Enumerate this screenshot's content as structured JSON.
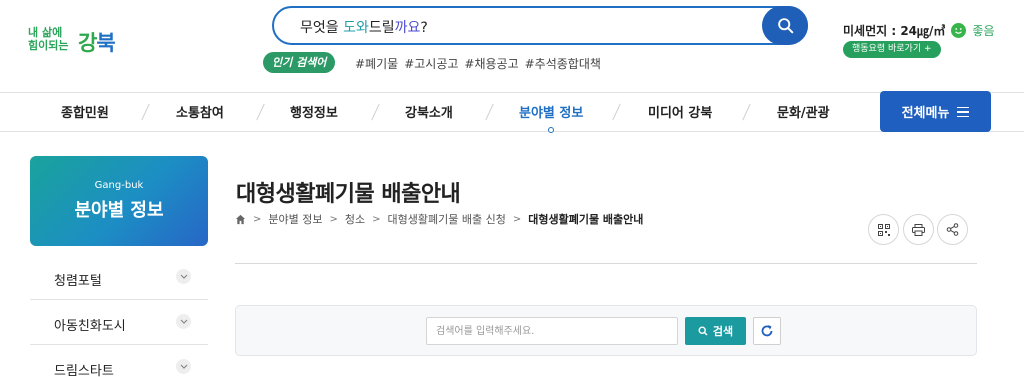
{
  "header": {
    "logo": {
      "line1": "내 삶에",
      "line2": "힘이되는",
      "brand_a": "강",
      "brand_b": "북"
    },
    "search": {
      "q_pre": "무엇을 ",
      "q_hl1": "도와",
      "q_mid": "드릴",
      "q_hl2": "까요",
      "q_end": "?"
    },
    "popular_label": "인기 검색어",
    "tags": [
      "#폐기물",
      "#고시공고",
      "#채용공고",
      "#추석종합대책"
    ],
    "dust_label": "미세먼지 : 24㎍/㎥",
    "dust_status": "좋음",
    "action_link": "행동요령 바로가기 +"
  },
  "gnb": {
    "items": [
      {
        "label": "종합민원"
      },
      {
        "label": "소통참여"
      },
      {
        "label": "행정정보"
      },
      {
        "label": "강북소개"
      },
      {
        "label": "분야별 정보"
      },
      {
        "label": "미디어 강북"
      },
      {
        "label": "문화/관광"
      }
    ],
    "all_menu": "전체메뉴"
  },
  "side": {
    "title_en": "Gang-buk",
    "title_ko": "분야별 정보",
    "items": [
      {
        "label": "청렴포털"
      },
      {
        "label": "아동친화도시"
      },
      {
        "label": "드림스타트"
      }
    ]
  },
  "content": {
    "title": "대형생활폐기물 배출안내",
    "breadcrumb": [
      "분야별 정보",
      "청소",
      "대형생활폐기물 배출 신청",
      "대형생활폐기물 배출안내"
    ],
    "search_placeholder": "검색어를 입력해주세요.",
    "search_button": "검색"
  },
  "colors": {
    "primary": "#1f5fbf",
    "green": "#2aa55a",
    "teal": "#1b9aa0"
  }
}
